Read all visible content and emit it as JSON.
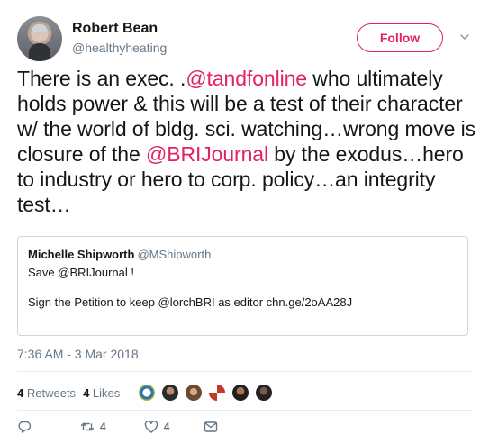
{
  "author": {
    "name": "Robert Bean",
    "handle": "@healthyheating"
  },
  "follow_label": "Follow",
  "tweet": {
    "segments": [
      {
        "text": "There is an exec. .",
        "mention": false
      },
      {
        "text": "@tandfonline",
        "mention": true
      },
      {
        "text": " who ultimately holds power & this will be a test of their character w/ the world of bldg. sci. watching…wrong move is closure of the ",
        "mention": false
      },
      {
        "text": "@BRIJournal",
        "mention": true
      },
      {
        "text": " by the exodus…hero to industry or hero to corp. policy…an integrity test…",
        "mention": false
      }
    ]
  },
  "quote": {
    "name": "Michelle Shipworth",
    "handle": "@MShipworth",
    "line1": "Save @BRIJournal !",
    "line2": "Sign the Petition to keep @lorchBRI as editor chn.ge/2oAA28J"
  },
  "timestamp": "7:36 AM - 3 Mar 2018",
  "stats": {
    "retweets_count": "4",
    "retweets_label": "Retweets",
    "likes_count": "4",
    "likes_label": "Likes"
  },
  "actions": {
    "reply_icon": "reply-icon",
    "retweet_count": "4",
    "like_count": "4",
    "message_icon": "envelope-icon"
  },
  "colors": {
    "accent": "#e0245e",
    "muted": "#657786",
    "border": "#e6ecf0"
  }
}
